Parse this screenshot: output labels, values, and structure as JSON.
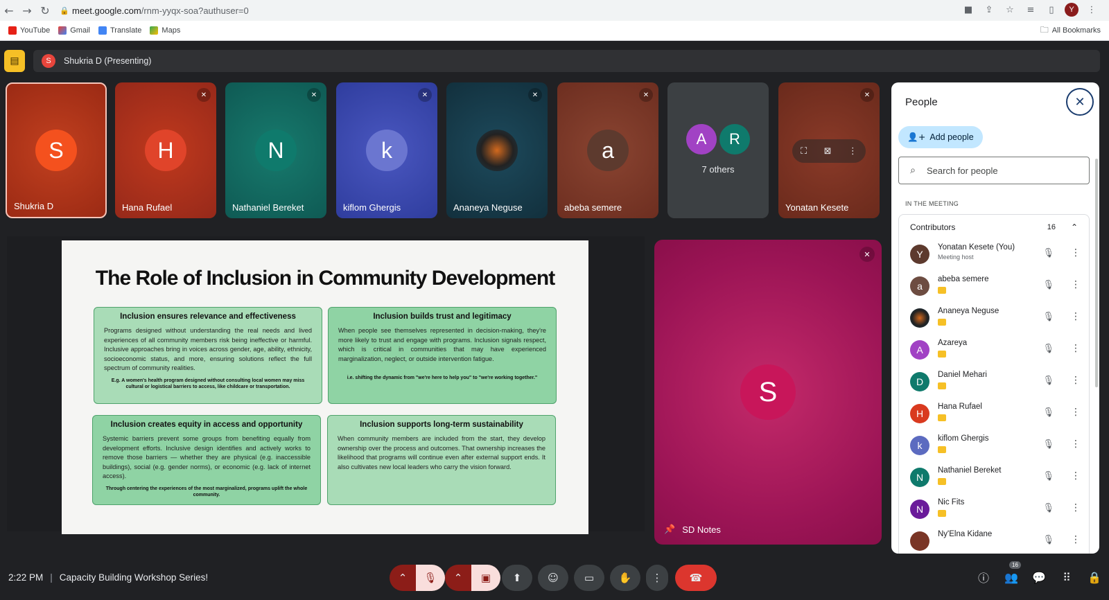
{
  "browser": {
    "url_host": "meet.google.com",
    "url_path": "/rnm-yyqx-soa?authuser=0",
    "profile_initial": "Y",
    "bookmarks": [
      "YouTube",
      "Gmail",
      "Translate",
      "Maps"
    ],
    "all_bookmarks": "All Bookmarks"
  },
  "presenting": {
    "initial": "S",
    "label": "Shukria D (Presenting)"
  },
  "tiles": [
    {
      "name": "Shukria D",
      "initial": "S",
      "color": "#e8453c",
      "bg": "#b5301a"
    },
    {
      "name": "Hana Rufael",
      "initial": "H",
      "color": "#d93a1f",
      "bg": "#a8301b"
    },
    {
      "name": "Nathaniel Bereket",
      "initial": "N",
      "color": "#0f7a6c",
      "bg": "#15625c"
    },
    {
      "name": "kiflom Ghergis",
      "initial": "k",
      "color": "#5c6bc0",
      "bg": "#3a47a8"
    },
    {
      "name": "Ananeya Neguse",
      "initial": "",
      "color": "#1d3b4a",
      "bg": "#173a4a"
    },
    {
      "name": "abeba semere",
      "initial": "a",
      "color": "#5d3a2e",
      "bg": "#7a3b2a"
    },
    {
      "name": "Yonatan Kesete",
      "initial": "",
      "color": "#6d3a2a",
      "bg": "#7a3526"
    }
  ],
  "others": {
    "initials": [
      "A",
      "R"
    ],
    "label": "7 others"
  },
  "slide": {
    "title": "The Role of Inclusion in Community Development",
    "boxes": [
      {
        "heading": "Inclusion ensures relevance and effectiveness",
        "body": "Programs designed without understanding the real needs and lived experiences of all community members risk being ineffective or harmful. Inclusive approaches bring in voices across gender, age, ability, ethnicity, socioeconomic status, and more, ensuring solutions reflect the full spectrum of community realities.",
        "example": "E.g. A women's health program designed without consulting local women may miss cultural or logistical barriers to access, like childcare or transportation."
      },
      {
        "heading": "Inclusion builds trust and legitimacy",
        "body": "When people see themselves represented in decision-making, they're more likely to trust and engage with programs. Inclusion signals respect, which is critical in communities that may have experienced marginalization, neglect, or outside intervention fatigue.",
        "example": "i.e. shifting the dynamic from \"we're here to help you\" to \"we're working together.\""
      },
      {
        "heading": "Inclusion creates equity in access and opportunity",
        "body": "Systemic barriers prevent some groups from benefiting equally from development efforts. Inclusive design identifies and actively works to remove those barriers — whether they are physical (e.g. inaccessible buildings), social (e.g. gender norms), or economic (e.g. lack of internet access).",
        "example": "Through centering the experiences of the most marginalized, programs uplift the whole community."
      },
      {
        "heading": "Inclusion supports long-term sustainability",
        "body": "When community members are included from the start, they develop ownership over the process and outcomes. That ownership increases the likelihood that programs will continue even after external support ends. It also cultivates new local leaders who carry the vision forward.",
        "example": ""
      }
    ]
  },
  "pinned": {
    "initial": "S",
    "label": "SD Notes"
  },
  "people_panel": {
    "title": "People",
    "add_people": "Add people",
    "search_placeholder": "Search for people",
    "section": "IN THE MEETING",
    "group_label": "Contributors",
    "group_count": "16",
    "people": [
      {
        "name": "Yonatan Kesete (You)",
        "sub": "Meeting host",
        "initial": "Y",
        "color": "#5d3a2e"
      },
      {
        "name": "abeba semere",
        "sub": "",
        "initial": "a",
        "color": "#6d4c41"
      },
      {
        "name": "Ananeya Neguse",
        "sub": "",
        "initial": "",
        "color": "#1d3b4a"
      },
      {
        "name": "Azareya",
        "sub": "",
        "initial": "A",
        "color": "#a142c4"
      },
      {
        "name": "Daniel Mehari",
        "sub": "",
        "initial": "D",
        "color": "#0f7a6c"
      },
      {
        "name": "Hana Rufael",
        "sub": "",
        "initial": "H",
        "color": "#d93a1f"
      },
      {
        "name": "kiflom Ghergis",
        "sub": "",
        "initial": "k",
        "color": "#5c6bc0"
      },
      {
        "name": "Nathaniel Bereket",
        "sub": "",
        "initial": "N",
        "color": "#0f7a6c"
      },
      {
        "name": "Nic Fits",
        "sub": "",
        "initial": "N",
        "color": "#6a1b9a"
      },
      {
        "name": "Ny'Elna Kidane",
        "sub": "",
        "initial": "",
        "color": "#7a3526"
      }
    ]
  },
  "bottom_bar": {
    "time": "2:22 PM",
    "separator": "|",
    "meeting_title": "Capacity Building Workshop Series!",
    "people_badge": "16"
  }
}
